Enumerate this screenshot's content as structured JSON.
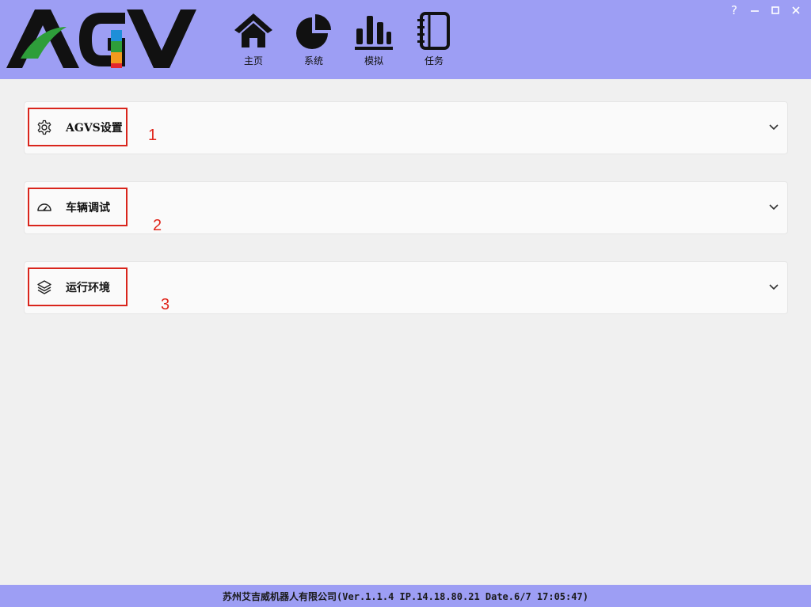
{
  "app": {
    "logo_text": "AGV"
  },
  "nav": [
    {
      "label": "主页",
      "icon": "home-icon"
    },
    {
      "label": "系统",
      "icon": "pie-chart-icon"
    },
    {
      "label": "模拟",
      "icon": "bar-chart-icon"
    },
    {
      "label": "任务",
      "icon": "notebook-icon"
    }
  ],
  "window_controls": {
    "help": "?",
    "minimize": "—"
  },
  "panels": [
    {
      "title": "AGVS设置",
      "icon": "gear-icon",
      "annotation": "1"
    },
    {
      "title": "车辆调试",
      "icon": "gauge-icon",
      "annotation": "2"
    },
    {
      "title": "运行环境",
      "icon": "layers-icon",
      "annotation": "3"
    }
  ],
  "footer": {
    "text": "苏州艾吉威机器人有限公司(Ver.1.1.4 IP.14.18.80.21 Date.6/7 17:05:47)"
  },
  "colors": {
    "header_bg": "#9d9ef4",
    "annotation_red": "#d9251c",
    "logo_green": "#2e9e3a",
    "logo_blue": "#1e8fd8",
    "logo_orange": "#f39a1d",
    "logo_red": "#e3262e"
  }
}
